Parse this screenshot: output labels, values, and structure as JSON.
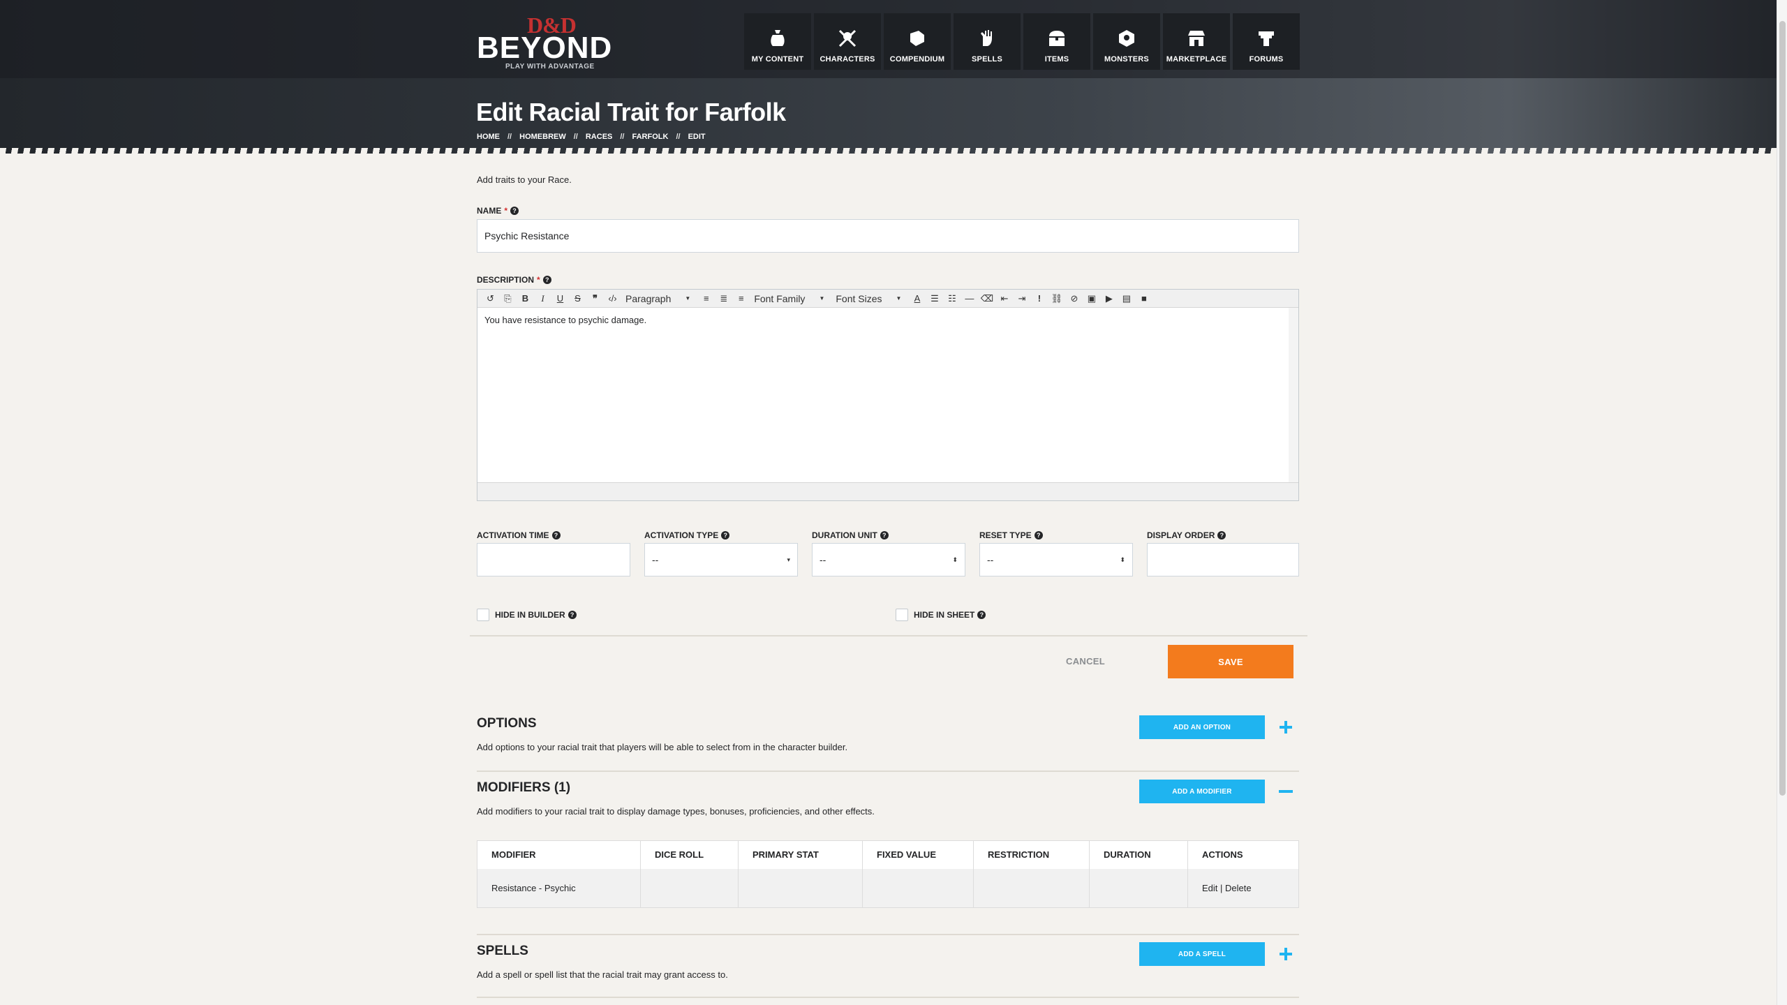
{
  "brand": {
    "logo_top": "D&D",
    "logo_main": "BEYOND",
    "tagline": "PLAY WITH ADVANTAGE",
    "accent_red": "#c53131"
  },
  "nav": [
    {
      "label": "MY CONTENT",
      "icon": "bag-icon"
    },
    {
      "label": "CHARACTERS",
      "icon": "crossed-swords-icon"
    },
    {
      "label": "COMPENDIUM",
      "icon": "book-icon"
    },
    {
      "label": "SPELLS",
      "icon": "hand-spell-icon"
    },
    {
      "label": "ITEMS",
      "icon": "chest-icon"
    },
    {
      "label": "MONSTERS",
      "icon": "monster-icon"
    },
    {
      "label": "MARKETPLACE",
      "icon": "store-icon"
    },
    {
      "label": "FORUMS",
      "icon": "forum-icon"
    }
  ],
  "page": {
    "title": "Edit Racial Trait for Farfolk",
    "breadcrumb": [
      "HOME",
      "HOMEBREW",
      "RACES",
      "FARFOLK",
      "EDIT"
    ],
    "breadcrumb_sep": "//",
    "intro": "Add traits to your Race."
  },
  "form": {
    "name_label": "NAME",
    "name_value": "Psychic Resistance",
    "description_label": "DESCRIPTION",
    "description_value": "You have resistance to psychic damage.",
    "required_mark": "*",
    "help_glyph": "?",
    "toolbar": {
      "paragraph": "Paragraph",
      "font_family": "Font Family",
      "font_sizes": "Font Sizes"
    },
    "activation_time_label": "ACTIVATION TIME",
    "activation_time_value": "",
    "activation_type_label": "ACTIVATION TYPE",
    "activation_type_value": "--",
    "duration_unit_label": "DURATION UNIT",
    "duration_unit_value": "--",
    "reset_type_label": "RESET TYPE",
    "reset_type_value": "--",
    "display_order_label": "DISPLAY ORDER",
    "display_order_value": "",
    "hide_in_builder_label": "HIDE IN BUILDER",
    "hide_in_sheet_label": "HIDE IN SHEET",
    "cancel_label": "CANCEL",
    "save_label": "SAVE",
    "save_color": "#f37b1d"
  },
  "sections": {
    "options": {
      "title": "OPTIONS",
      "desc": "Add options to your racial trait that players will be able to select from in the character builder.",
      "button": "ADD AN OPTION"
    },
    "modifiers": {
      "title": "MODIFIERS (1)",
      "desc": "Add modifiers to your racial trait to display damage types, bonuses, proficiencies, and other effects.",
      "button": "ADD A MODIFIER",
      "columns": [
        "MODIFIER",
        "DICE ROLL",
        "PRIMARY STAT",
        "FIXED VALUE",
        "RESTRICTION",
        "DURATION",
        "ACTIONS"
      ],
      "rows": [
        {
          "modifier": "Resistance - Psychic",
          "dice_roll": "",
          "primary_stat": "",
          "fixed_value": "",
          "restriction": "",
          "duration": "",
          "edit": "Edit",
          "sep": "|",
          "delete": "Delete"
        }
      ]
    },
    "spells": {
      "title": "SPELLS",
      "desc": "Add a spell or spell list that the racial trait may grant access to.",
      "button": "ADD A SPELL"
    },
    "button_color": "#1fb4f0"
  }
}
